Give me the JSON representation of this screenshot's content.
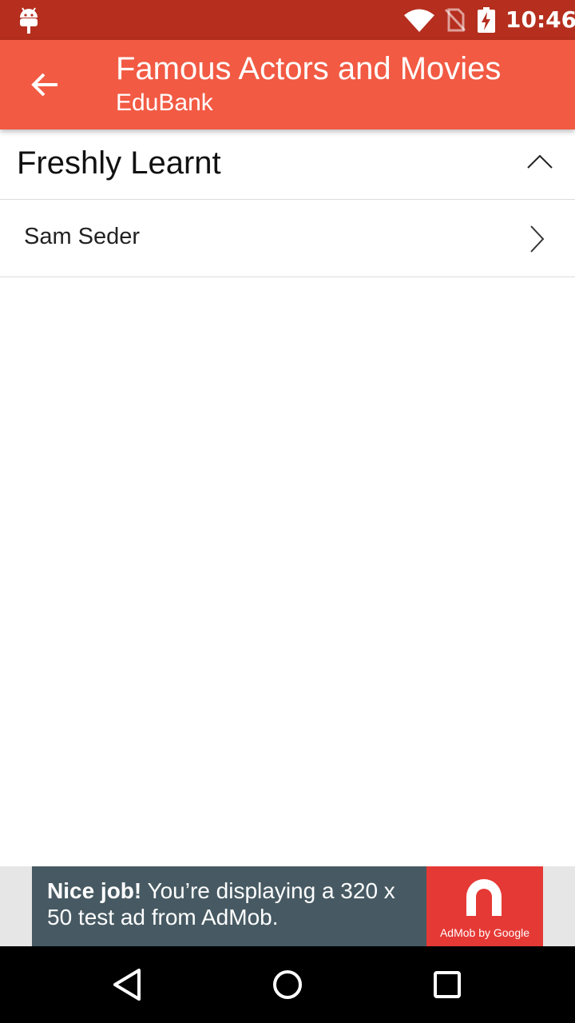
{
  "status_bar": {
    "time": "10:46",
    "icons": [
      "android-icon",
      "wifi-icon",
      "no-sim-icon",
      "battery-charging-icon"
    ]
  },
  "app_bar": {
    "title": "Famous Actors and Movies",
    "subtitle": "EduBank",
    "back_icon": "arrow-left-icon",
    "background_color": "#f25a43",
    "status_color": "#b52e1e"
  },
  "section": {
    "title": "Freshly Learnt",
    "expanded": true,
    "toggle_icon": "chevron-up-icon"
  },
  "items": [
    {
      "label": "Sam Seder",
      "icon": "chevron-right-icon"
    }
  ],
  "ad": {
    "bold_text": "Nice job!",
    "text": " You’re displaying a 320 x 50 test ad from AdMob.",
    "logo_text": "AdMob by Google",
    "banner_color": "#475a63",
    "logo_color": "#e53935"
  },
  "nav_bar": {
    "buttons": [
      "back-triangle-icon",
      "home-circle-icon",
      "recents-square-icon"
    ]
  }
}
